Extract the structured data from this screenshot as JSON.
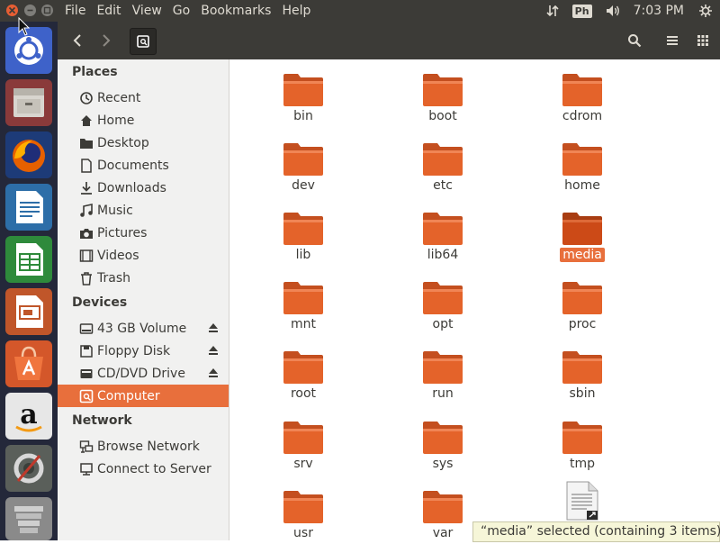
{
  "menu": [
    "File",
    "Edit",
    "View",
    "Go",
    "Bookmarks",
    "Help"
  ],
  "indicators": {
    "keyboard": "Ph",
    "clock": "7:03 PM"
  },
  "sidebar": {
    "places_title": "Places",
    "places": [
      {
        "label": "Recent",
        "icon": "clock-icon"
      },
      {
        "label": "Home",
        "icon": "home-icon"
      },
      {
        "label": "Desktop",
        "icon": "folder-icon"
      },
      {
        "label": "Documents",
        "icon": "document-icon"
      },
      {
        "label": "Downloads",
        "icon": "download-icon"
      },
      {
        "label": "Music",
        "icon": "music-icon"
      },
      {
        "label": "Pictures",
        "icon": "camera-icon"
      },
      {
        "label": "Videos",
        "icon": "video-icon"
      },
      {
        "label": "Trash",
        "icon": "trash-icon"
      }
    ],
    "devices_title": "Devices",
    "devices": [
      {
        "label": "43 GB Volume",
        "icon": "drive-icon",
        "eject": true
      },
      {
        "label": "Floppy Disk",
        "icon": "floppy-icon",
        "eject": true
      },
      {
        "label": "CD/DVD Drive",
        "icon": "optical-drive-icon",
        "eject": true
      },
      {
        "label": "Computer",
        "icon": "computer-icon",
        "eject": false,
        "active": true
      }
    ],
    "network_title": "Network",
    "network": [
      {
        "label": "Browse Network",
        "icon": "network-icon"
      },
      {
        "label": "Connect to Server",
        "icon": "server-icon"
      }
    ]
  },
  "folders": [
    "bin",
    "boot",
    "cdrom",
    "dev",
    "etc",
    "home",
    "lib",
    "lib64",
    "media",
    "mnt",
    "opt",
    "proc",
    "root",
    "run",
    "sbin",
    "srv",
    "sys",
    "tmp",
    "usr",
    "var"
  ],
  "selected_folder": "media",
  "status": "“media” selected  (containing 3 items)",
  "colors": {
    "accent": "#e86f3c",
    "folder": "#e4632a",
    "panel": "#3c3b37",
    "launcher": "#24283a"
  }
}
